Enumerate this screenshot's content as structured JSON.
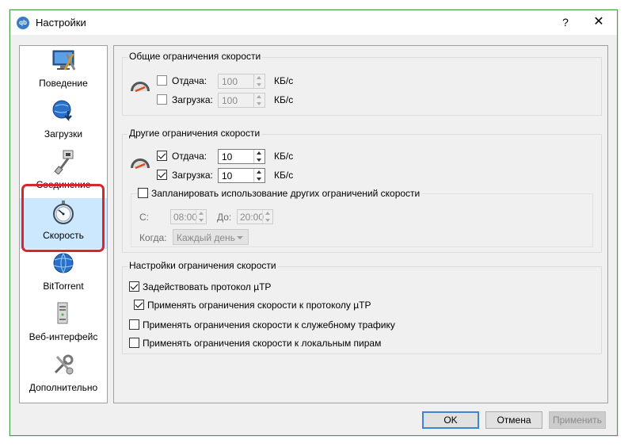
{
  "window": {
    "title": "Настройки",
    "help": "?",
    "close": "✕",
    "app_icon": "qb"
  },
  "sidebar": {
    "items": [
      {
        "label": "Поведение",
        "icon": "monitor-tools-icon"
      },
      {
        "label": "Загрузки",
        "icon": "globe-download-icon"
      },
      {
        "label": "Соединение",
        "icon": "network-plug-icon"
      },
      {
        "label": "Скорость",
        "icon": "stopwatch-icon",
        "selected": true
      },
      {
        "label": "BitTorrent",
        "icon": "globe-icon"
      },
      {
        "label": "Веб-интерфейс",
        "icon": "tower-icon"
      },
      {
        "label": "Дополнительно",
        "icon": "tools-icon"
      }
    ]
  },
  "global_limits": {
    "title": "Общие ограничения скорости",
    "upload": {
      "label": "Отдача:",
      "value": "100",
      "unit": "КБ/с",
      "checked": false
    },
    "download": {
      "label": "Загрузка:",
      "value": "100",
      "unit": "КБ/с",
      "checked": false
    }
  },
  "alt_limits": {
    "title": "Другие ограничения скорости",
    "upload": {
      "label": "Отдача:",
      "value": "10",
      "unit": "КБ/с",
      "checked": true
    },
    "download": {
      "label": "Загрузка:",
      "value": "10",
      "unit": "КБ/с",
      "checked": true
    },
    "schedule": {
      "label": "Запланировать использование других ограничений скорости",
      "checked": false,
      "from_label": "С:",
      "from": "08:00",
      "to_label": "До:",
      "to": "20:00",
      "when_label": "Когда:",
      "when": "Каждый день"
    }
  },
  "limit_settings": {
    "title": "Настройки ограничения скорости",
    "options": [
      {
        "label": "Задействовать протокол µTP",
        "checked": true
      },
      {
        "label": "Применять ограничения скорости к протоколу µTP",
        "checked": true
      },
      {
        "label": "Применять ограничения скорости к служебному трафику",
        "checked": false
      },
      {
        "label": "Применять ограничения скорости к локальным пирам",
        "checked": false
      }
    ]
  },
  "buttons": {
    "ok": "OK",
    "cancel": "Отмена",
    "apply": "Применить"
  },
  "colors": {
    "accent": "#3c84d6",
    "highlight": "#d8262b",
    "selection": "#cce8ff"
  }
}
